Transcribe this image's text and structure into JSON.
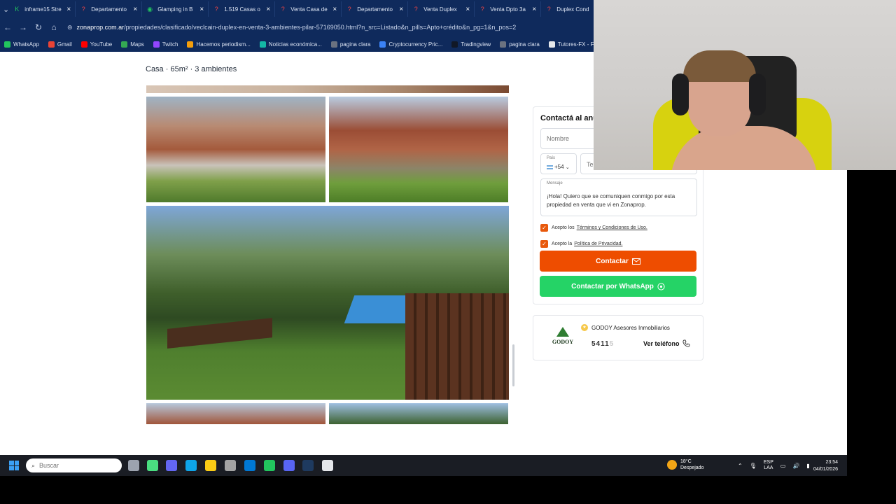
{
  "browser": {
    "tabs": [
      {
        "label": "inframe15 Stre",
        "color": "#22c55e",
        "glyph": "K"
      },
      {
        "label": "Departamento",
        "color": "#ef4444",
        "glyph": "?"
      },
      {
        "label": "Glamping in B",
        "color": "#22c55e",
        "glyph": "◉"
      },
      {
        "label": "1.519 Casas o",
        "color": "#ef4444",
        "glyph": "?"
      },
      {
        "label": "Venta Casa de",
        "color": "#ef4444",
        "glyph": "?"
      },
      {
        "label": "Departamento",
        "color": "#ef4444",
        "glyph": "?"
      },
      {
        "label": "Venta Duplex",
        "color": "#ef4444",
        "glyph": "?"
      },
      {
        "label": "Venta Dpto 3a",
        "color": "#ef4444",
        "glyph": "?"
      },
      {
        "label": "Duplex Cond",
        "color": "#ef4444",
        "glyph": "?"
      }
    ],
    "url_domain": "zonaprop.com.ar",
    "url_path": "/propiedades/clasificado/veclcain-duplex-en-venta-3-ambientes-pilar-57169050.html?n_src=Listado&n_pills=Apto+crédito&n_pg=1&n_pos=2",
    "bookmarks": [
      {
        "label": "WhatsApp",
        "color": "#22c55e"
      },
      {
        "label": "Gmail",
        "color": "#ea4335"
      },
      {
        "label": "YouTube",
        "color": "#ff0000"
      },
      {
        "label": "Maps",
        "color": "#34a853"
      },
      {
        "label": "Twitch",
        "color": "#9146ff"
      },
      {
        "label": "Hacemos periodism...",
        "color": "#f59e0b"
      },
      {
        "label": "Noticias económica...",
        "color": "#14b8a6"
      },
      {
        "label": "pagina clara",
        "color": "#6b7280"
      },
      {
        "label": "Cryptocurrency Pric...",
        "color": "#3b82f6"
      },
      {
        "label": "Tradingview",
        "color": "#111827"
      },
      {
        "label": "pagina clara",
        "color": "#6b7280"
      },
      {
        "label": "Tutores-FX - Forma...",
        "color": "#e5e7eb"
      },
      {
        "label": "A",
        "color": "#2563eb"
      }
    ]
  },
  "listing": {
    "summary": "Casa · 65m² · 3 ambientes"
  },
  "contact": {
    "title": "Contactá al anu",
    "name_placeholder": "Nombre",
    "country_label": "País",
    "country_code": "+54",
    "phone_placeholder": "Tel",
    "message_label": "Mensaje",
    "message_text": "¡Hola! Quiero que se comuniquen conmigo por esta propiedad en venta que vi en Zonaprop.",
    "terms_prefix": "Acepto los",
    "terms_link": "Términos y Condiciones de Uso.",
    "privacy_prefix": "Acepto la",
    "privacy_link": "Política de Privacidad.",
    "contact_button": "Contactar",
    "whatsapp_button": "Contactar por WhatsApp"
  },
  "agent": {
    "logo_text": "GODOY",
    "name": "GODOY Asesores Inmobiliarios",
    "phone_visible": "5411",
    "phone_faded": "5",
    "view_phone": "Ver teléfono"
  },
  "taskbar": {
    "search_placeholder": "Buscar",
    "weather_temp": "18°C",
    "weather_desc": "Despejado",
    "lang_top": "ESP",
    "lang_bottom": "LAA",
    "time": "23:54",
    "date": "04/01/2026",
    "apps": [
      {
        "name": "task-view",
        "color": "#9ca3af"
      },
      {
        "name": "chrome-dev",
        "color": "#4ade80"
      },
      {
        "name": "teams",
        "color": "#6366f1"
      },
      {
        "name": "edge",
        "color": "#0ea5e9"
      },
      {
        "name": "explorer",
        "color": "#facc15"
      },
      {
        "name": "store",
        "color": "#a3a3a3"
      },
      {
        "name": "outlook",
        "color": "#0078d4"
      },
      {
        "name": "chrome",
        "color": "#22c55e"
      },
      {
        "name": "discord",
        "color": "#5865f2"
      },
      {
        "name": "steam",
        "color": "#1e3a5f"
      },
      {
        "name": "app-red",
        "color": "#e5e7eb"
      }
    ]
  }
}
